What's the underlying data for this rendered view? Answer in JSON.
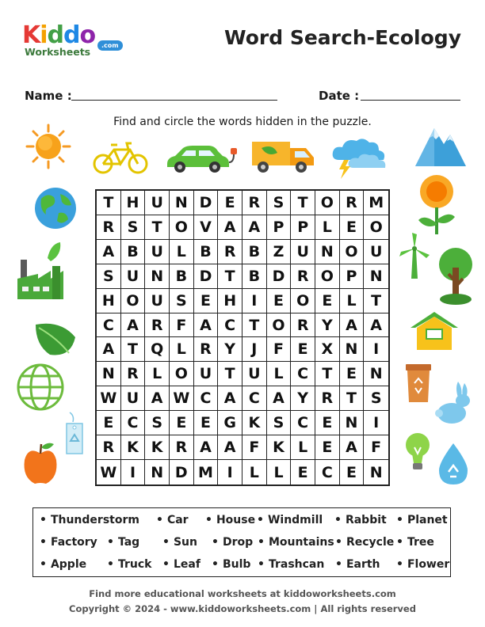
{
  "logo": {
    "kiddo": "Kiddo",
    "worksheets": "Worksheets",
    "com": ".com"
  },
  "title": "Word Search-Ecology",
  "name_label": "Name :",
  "date_label": "Date :",
  "instruction": "Find and circle the words hidden in the puzzle.",
  "grid": [
    "THUNDERSTORM",
    "RSTOVAAPPLEO",
    "ABULBRBZUNOU",
    "SUNBDTBDROPN",
    "HOUSEHIEOELT",
    "CARFACTORYAA",
    "ATQLRYJFEXNI",
    "NRLOUTULCTEN",
    "WUAWCACAYRTS",
    "ECSEEGKSCENI",
    "RKKRAAFKLEAF",
    "WINDMILLECEN"
  ],
  "word_bank": [
    [
      "Thunderstorm",
      "Car",
      "House",
      "Windmill",
      "Rabbit",
      "Planet"
    ],
    [
      "Factory",
      "Tag",
      "Sun",
      "Drop",
      "Mountains",
      "Recycle",
      "Tree"
    ],
    [
      "Apple",
      "Truck",
      "Leaf",
      "Bulb",
      "Trashcan",
      "Earth",
      "Flower"
    ]
  ],
  "footer": {
    "line1": "Find more educational worksheets at kiddoworksheets.com",
    "line2": "Copyright © 2024 - www.kiddoworksheets.com  |  All rights reserved"
  },
  "icons": [
    "sun-icon",
    "bicycle-icon",
    "car-icon",
    "truck-icon",
    "storm-cloud-icon",
    "mountains-icon",
    "earth-icon",
    "flower-icon",
    "factory-icon",
    "windmill-icon",
    "tree-icon",
    "leaf-icon",
    "house-icon",
    "globe-icon",
    "trashcan-icon",
    "tag-icon",
    "rabbit-icon",
    "apple-icon",
    "bulb-icon",
    "recycle-drop-icon"
  ],
  "colors": {
    "logo_blue": "#2f8fd8",
    "logo_green": "#3c7a3c",
    "text": "#222222"
  }
}
